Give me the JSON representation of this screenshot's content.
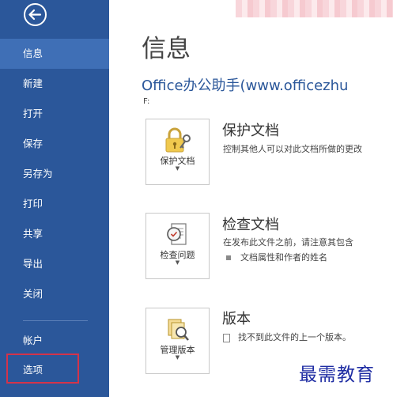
{
  "sidebar": {
    "items": [
      {
        "label": "信息",
        "active": true
      },
      {
        "label": "新建"
      },
      {
        "label": "打开"
      },
      {
        "label": "保存"
      },
      {
        "label": "另存为"
      },
      {
        "label": "打印"
      },
      {
        "label": "共享"
      },
      {
        "label": "导出"
      },
      {
        "label": "关闭"
      },
      {
        "label": "帐户"
      },
      {
        "label": "选项",
        "highlighted": true
      }
    ],
    "back_icon": "back-arrow-icon"
  },
  "main": {
    "title": "信息",
    "doc_name": "Office办公助手(www.officezhu",
    "doc_path": "F:",
    "sections": [
      {
        "tile_label": "保护文档",
        "icon": "lock-key-icon",
        "title": "保护文档",
        "desc": "控制其他人可以对此文档所做的更改"
      },
      {
        "tile_label": "检查问题",
        "icon": "inspect-document-icon",
        "title": "检查文档",
        "desc": "在发布此文件之前，请注意其包含",
        "bullet": "文档属性和作者的姓名"
      },
      {
        "tile_label": "管理版本",
        "icon": "manage-versions-icon",
        "title": "版本",
        "desc": "找不到此文件的上一个版本。"
      }
    ]
  },
  "watermark": "最需教育",
  "colors": {
    "sidebar": "#2b579a",
    "sidebar_active": "#3f6fb6",
    "highlight_outline": "#d4334a",
    "accent_text": "#2b579a"
  }
}
